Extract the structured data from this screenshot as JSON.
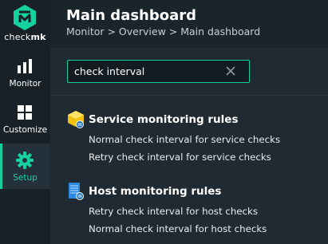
{
  "brand": {
    "name_light": "check",
    "name_bold": "mk"
  },
  "nav": {
    "monitor_label": "Monitor",
    "customize_label": "Customize",
    "setup_label": "Setup",
    "active": "Setup"
  },
  "header": {
    "title": "Main dashboard",
    "breadcrumb": "Monitor > Overview > Main dashboard"
  },
  "search": {
    "value": "check interval"
  },
  "results": [
    {
      "title": "Service monitoring rules",
      "icon": "service-rules-icon",
      "items": [
        "Normal check interval for service checks",
        "Retry check interval for service checks"
      ]
    },
    {
      "title": "Host monitoring rules",
      "icon": "host-rules-icon",
      "items": [
        "Retry check interval for host checks",
        "Normal check interval for host checks"
      ]
    }
  ],
  "colors": {
    "accent": "#15d1a0",
    "sidebar": "#182127",
    "background": "#1f2a32"
  }
}
